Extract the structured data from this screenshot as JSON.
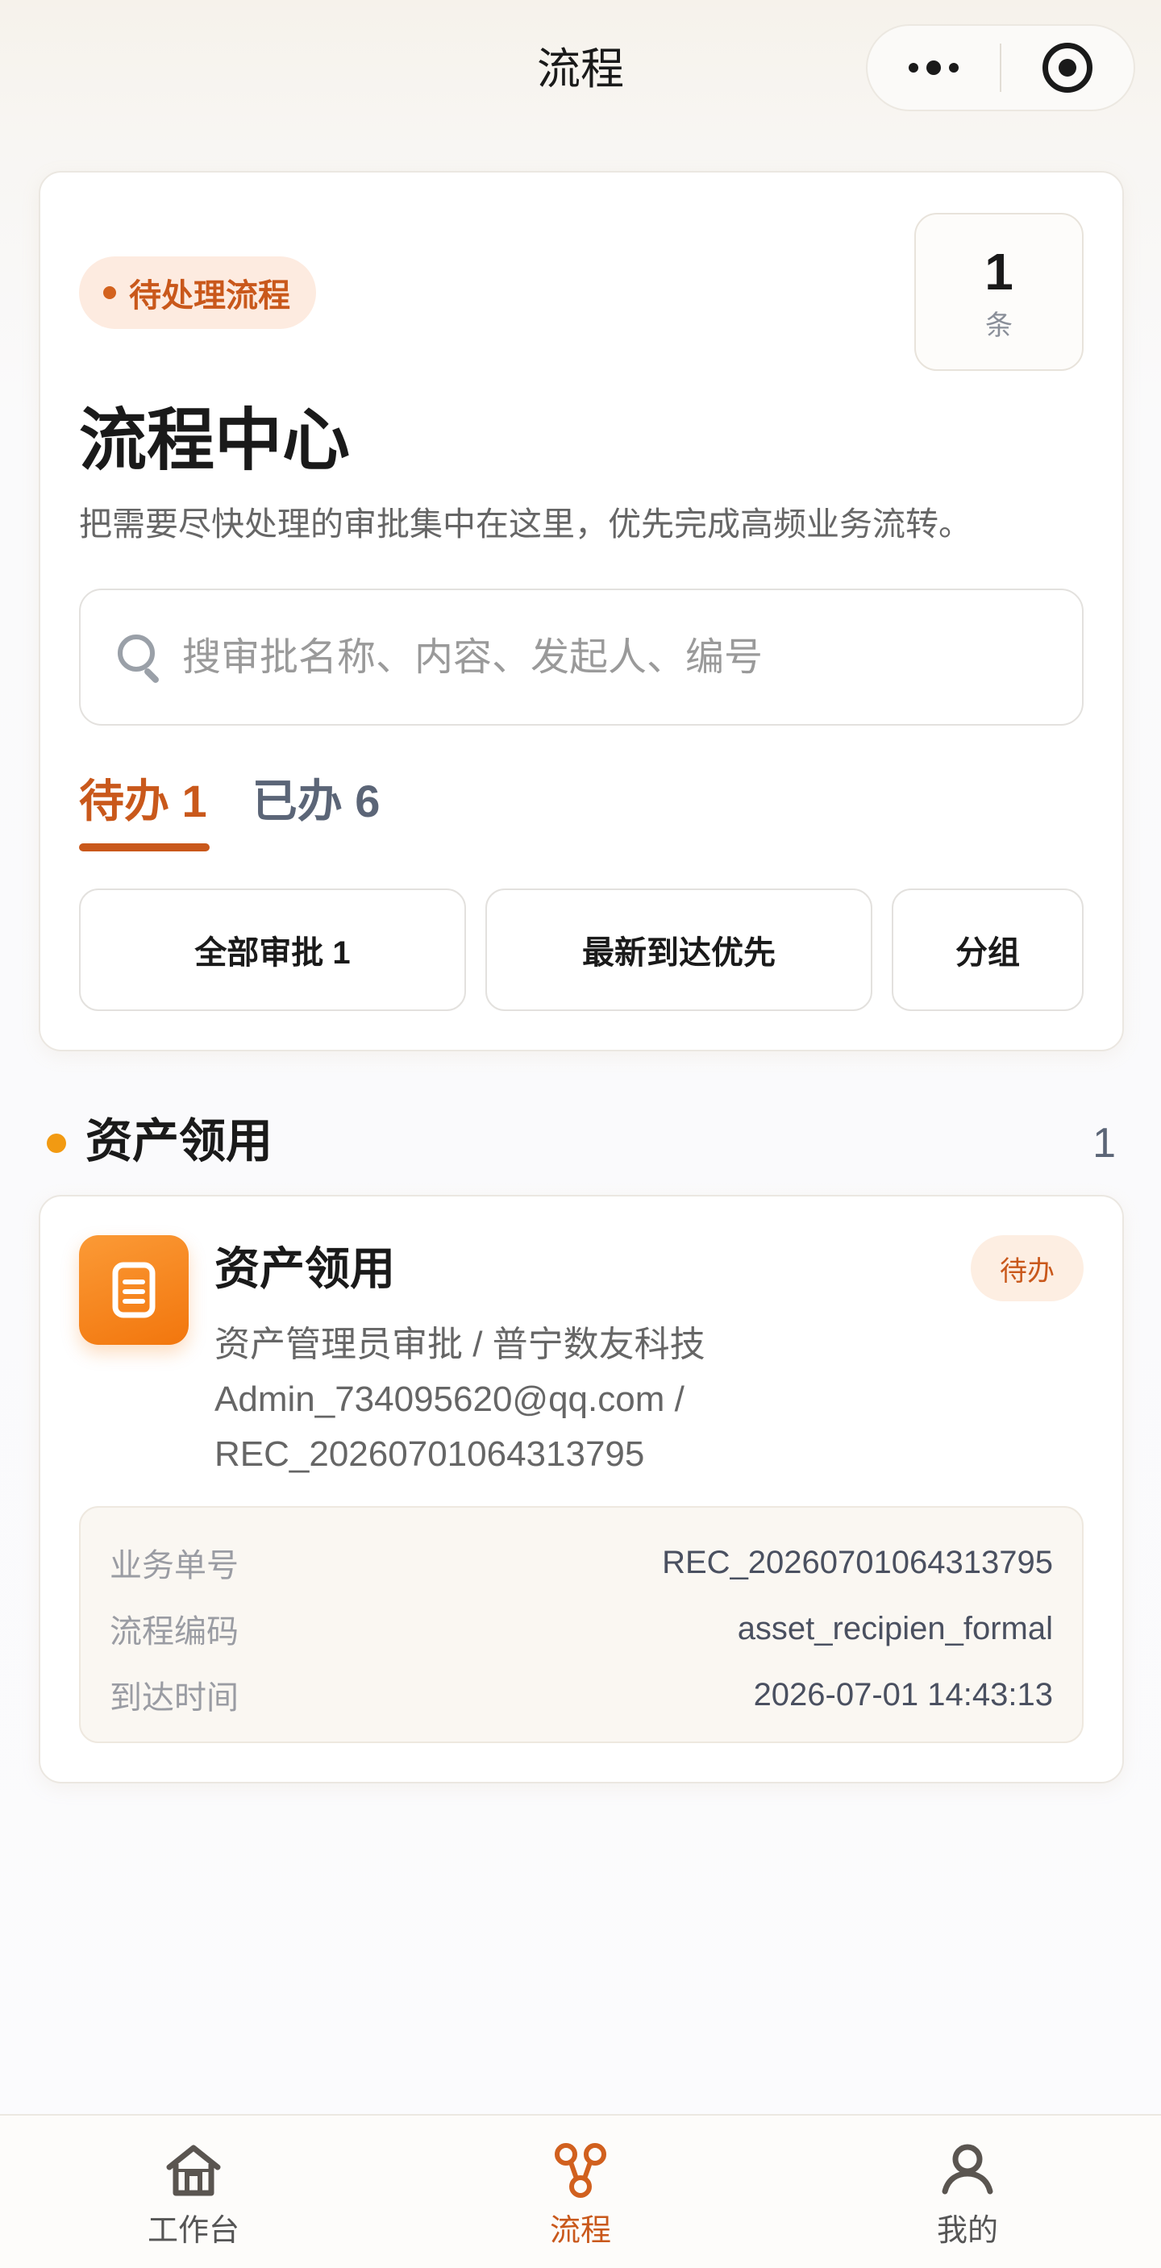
{
  "header": {
    "title": "流程"
  },
  "summary": {
    "badge_label": "待处理流程",
    "count": "1",
    "count_unit": "条",
    "title": "流程中心",
    "description": "把需要尽快处理的审批集中在这里，优先完成高频业务流转。"
  },
  "search": {
    "placeholder": "搜审批名称、内容、发起人、编号",
    "value": ""
  },
  "tabs": [
    {
      "label": "待办 1",
      "active": true
    },
    {
      "label": "已办 6",
      "active": false
    }
  ],
  "filters": {
    "all": "全部审批 1",
    "latest": "最新到达优先",
    "group": "分组"
  },
  "section": {
    "title": "资产领用",
    "count": "1"
  },
  "item": {
    "icon": "document-icon",
    "title": "资产领用",
    "status": "待办",
    "lines": [
      "资产管理员审批 / 普宁数友科技",
      "Admin_734095620@qq.com /",
      "REC_20260701064313795"
    ],
    "details": [
      {
        "label": "业务单号",
        "value": "REC_20260701064313795"
      },
      {
        "label": "流程编码",
        "value": "asset_recipien_formal"
      },
      {
        "label": "到达时间",
        "value": "2026-07-01 14:43:13"
      }
    ]
  },
  "tabbar": [
    {
      "label": "工作台",
      "icon": "home-icon",
      "active": false
    },
    {
      "label": "流程",
      "icon": "workflow-icon",
      "active": true
    },
    {
      "label": "我的",
      "icon": "user-icon",
      "active": false
    }
  ],
  "colors": {
    "accent": "#c9581b",
    "orange_icon": "#f2760d",
    "dot": "#f29a12",
    "muted_text": "#5b6577"
  }
}
